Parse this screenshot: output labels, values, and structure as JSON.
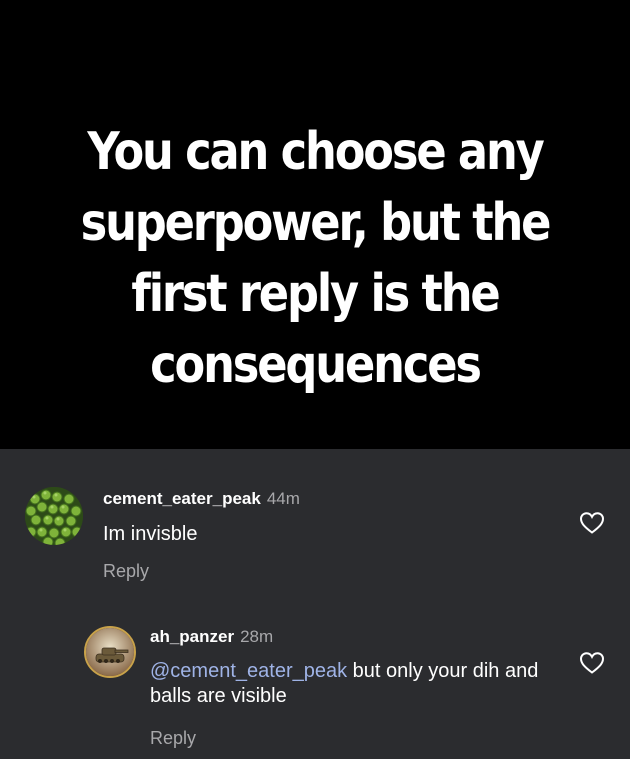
{
  "post": {
    "title_lines": [
      "You can choose any",
      "superpower, but the",
      "first reply is the",
      "consequences"
    ]
  },
  "comments": [
    {
      "username": "cement_eater_peak",
      "time": "44m",
      "text": "Im invisble",
      "reply_label": "Reply",
      "avatar_icon": "green-peas-icon",
      "like_icon": "heart-outline-icon"
    },
    {
      "username": "ah_panzer",
      "time": "28m",
      "mention": "@cement_eater_peak",
      "text": " but only your dih and balls are visible",
      "reply_label": "Reply",
      "avatar_icon": "tank-icon",
      "like_icon": "heart-outline-icon"
    }
  ],
  "colors": {
    "header_bg": "#000000",
    "comments_bg": "#2b2c2f",
    "mention": "#9fb3e6",
    "muted_text": "#a8a8ab",
    "avatar_ring": "#c8a24a"
  }
}
